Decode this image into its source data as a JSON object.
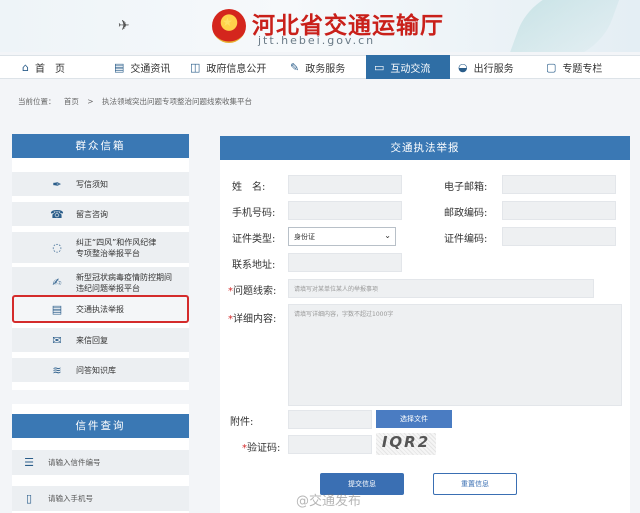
{
  "header": {
    "title": "河北省交通运输厅",
    "url": "jtt.hebei.gov.cn"
  },
  "nav": [
    {
      "label": "首　页",
      "icon": "home-icon"
    },
    {
      "label": "交通资讯",
      "icon": "document-icon"
    },
    {
      "label": "政府信息公开",
      "icon": "book-icon"
    },
    {
      "label": "政务服务",
      "icon": "edit-icon"
    },
    {
      "label": "互动交流",
      "icon": "chat-icon",
      "active": true
    },
    {
      "label": "出行服务",
      "icon": "car-icon"
    },
    {
      "label": "专题专栏",
      "icon": "folder-icon"
    }
  ],
  "breadcrumb": {
    "prefix": "当前位置：",
    "home": "首页",
    "separator": ">",
    "current": "执法领域突出问题专项整治问题线索收集平台"
  },
  "sidebar": {
    "title": "群众信箱",
    "items": [
      {
        "label": "写信须知",
        "icon": "pen-icon"
      },
      {
        "label": "留言咨询",
        "icon": "phone-icon"
      },
      {
        "label": "纠正“四风”和作风纪律专项整治举报平台",
        "line1": "纠正“四风”和作风纪律",
        "line2": "专项整治举报平台",
        "icon": "bulb-icon"
      },
      {
        "label": "新型冠状病毒疫情防控期间违纪问题举报平台",
        "line1": "新型冠状病毒疫情防控期间",
        "line2": "违纪问题举报平台",
        "icon": "edit-icon"
      },
      {
        "label": "交通执法举报",
        "icon": "document-icon"
      },
      {
        "label": "来信回复",
        "icon": "mail-icon"
      },
      {
        "label": "问答知识库",
        "icon": "stack-icon"
      }
    ]
  },
  "query": {
    "title": "信件查询",
    "items": [
      {
        "placeholder": "请输入信件编号",
        "icon": "list-icon"
      },
      {
        "placeholder": "请输入手机号",
        "icon": "mobile-icon"
      }
    ]
  },
  "form": {
    "title": "交通执法举报",
    "name_label": "姓　名:",
    "email_label": "电子邮箱:",
    "phone_label": "手机号码:",
    "postcode_label": "邮政编码:",
    "idtype_label": "证件类型:",
    "idtype_value": "身份证",
    "idnum_label": "证件编码:",
    "address_label": "联系地址:",
    "clue_label": "问题线索:",
    "clue_placeholder": "请填写对某单位某人的举报事项",
    "detail_label": "详细内容:",
    "detail_placeholder": "请填写详细内容，字数不超过1000字",
    "attach_label": "附件:",
    "choose_file": "选择文件",
    "captcha_label": "验证码:",
    "captcha_text": "IQR2",
    "submit": "提交信息",
    "reset": "重置信息"
  },
  "watermark": "@交通发布",
  "colors": {
    "primary": "#3a78b4",
    "highlight_border": "#d42b2b",
    "title_red": "#c9201a"
  }
}
